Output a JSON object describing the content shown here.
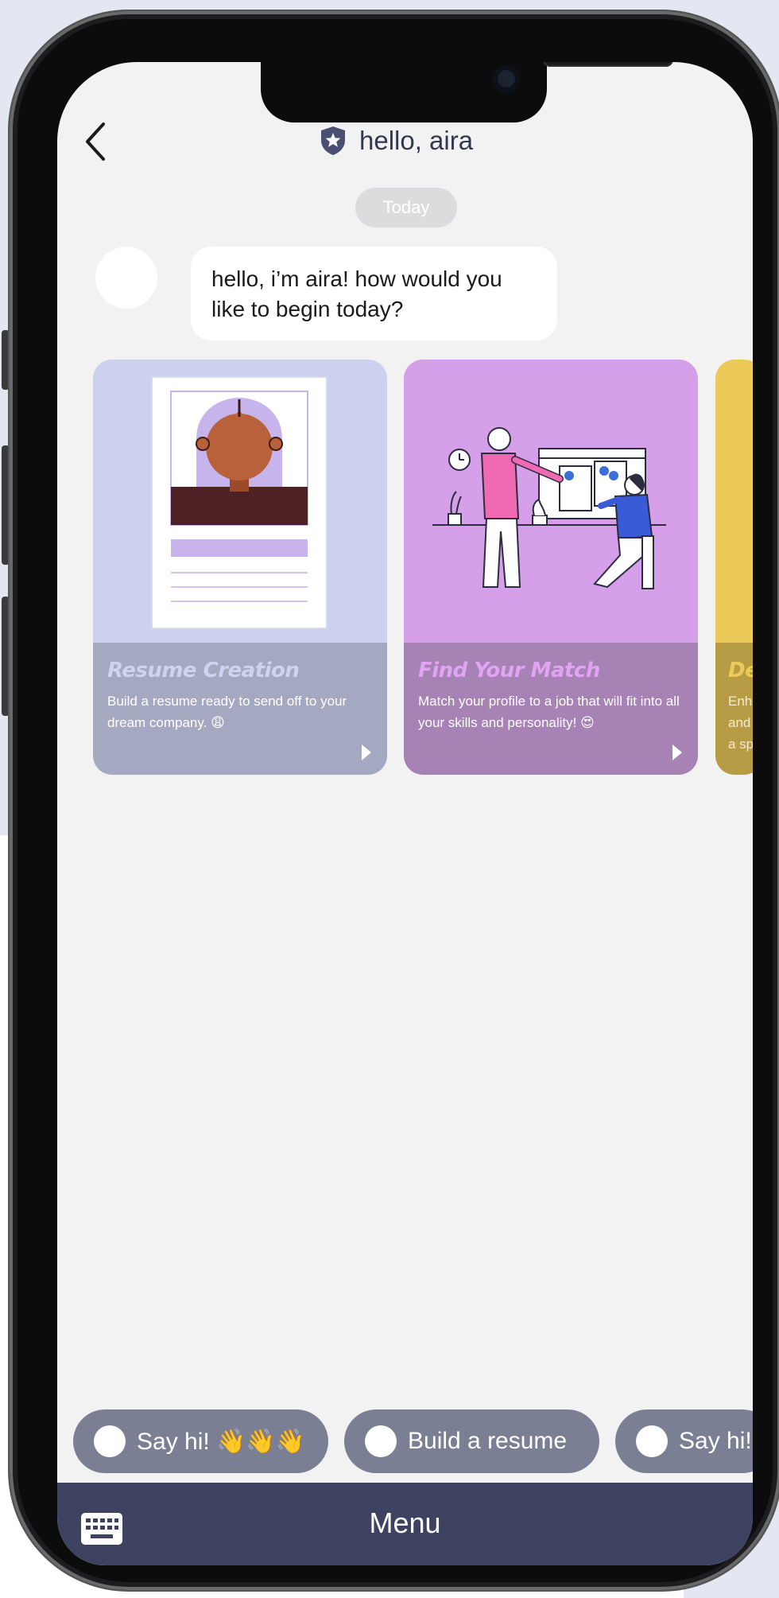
{
  "header": {
    "title": "hello, aira",
    "back_icon": "chevron-left-icon",
    "badge_icon": "shield-star-icon"
  },
  "chat": {
    "date_label": "Today",
    "bot_message": "hello, i’m aira! how would you like to begin today?"
  },
  "cards": [
    {
      "title": "Resume Creation",
      "description": "Build a resume ready to send off to your dream company. 😩",
      "icon": "play-arrow-icon"
    },
    {
      "title": "Find Your Match",
      "description": "Match your profile to a job that will fit into all your skills and personality! 😍",
      "icon": "play-arrow-icon"
    },
    {
      "title": "De",
      "description": "Enh and a sp",
      "icon": "play-arrow-icon"
    }
  ],
  "quick_replies": [
    {
      "label": "Say hi! 👋👋👋"
    },
    {
      "label": "Build a resume"
    },
    {
      "label": "Say hi!"
    }
  ],
  "bottom_bar": {
    "menu_label": "Menu",
    "keyboard_icon": "keyboard-icon"
  },
  "colors": {
    "header_text": "#33374f",
    "bottom_bar": "#3d4260",
    "chip": "#7b7f93",
    "card_resume": "#cbd1ee",
    "card_match": "#d59fe9",
    "card_third": "#ecca5a"
  }
}
